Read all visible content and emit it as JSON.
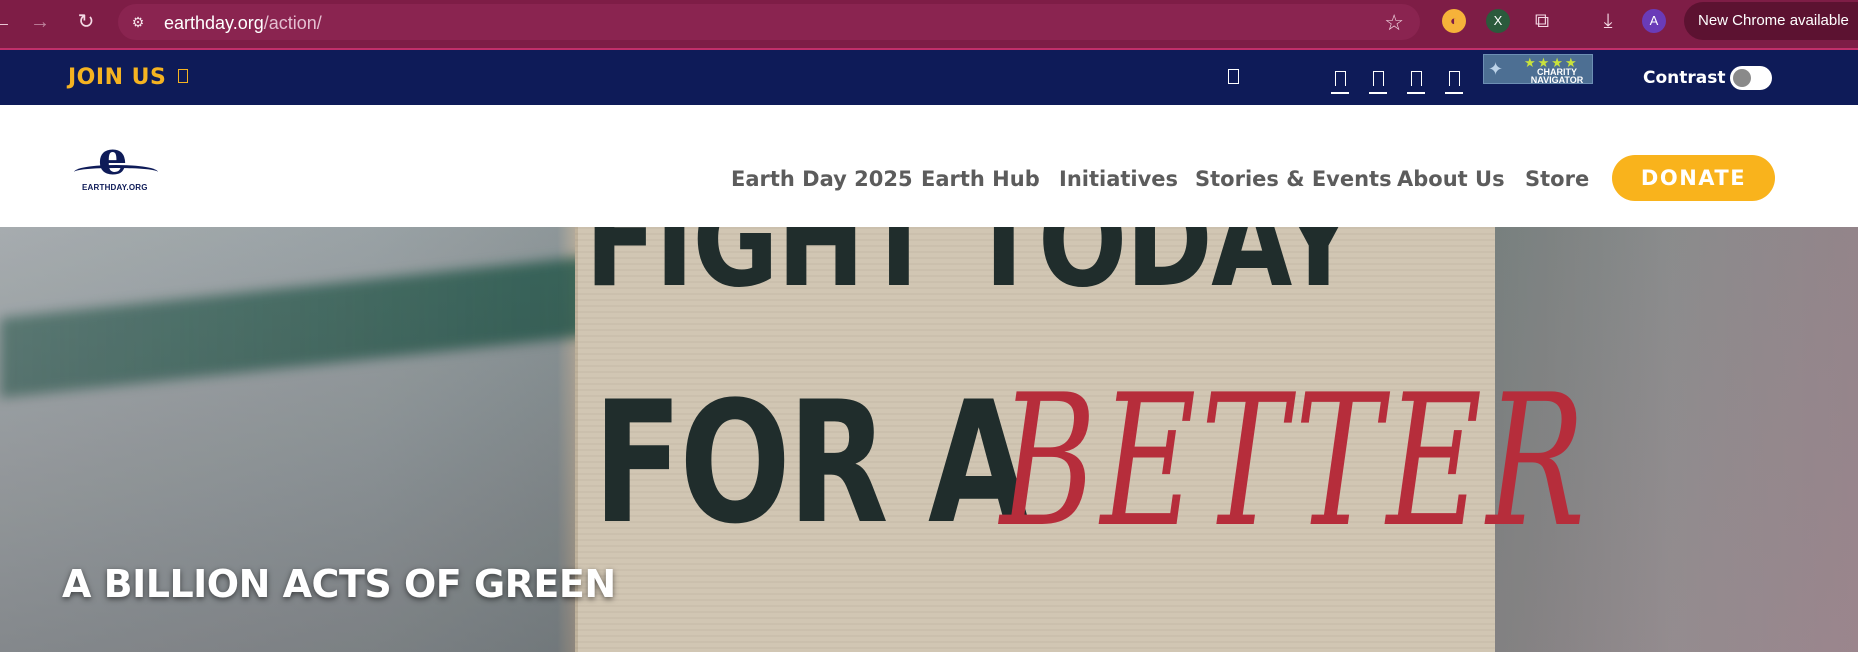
{
  "browser": {
    "url_domain": "earthday.org",
    "url_path": "/action/",
    "new_chrome_label": "New Chrome available",
    "profile_initial": "A",
    "extension_x_label": "X",
    "theme_color": "#7e1d46"
  },
  "topbar": {
    "join_label": "JOIN US",
    "contrast_label": "Contrast",
    "charity_navigator_text": "CHARITY NAVIGATOR",
    "charity_stars": "★★★★",
    "bar_color": "#0e1b58",
    "accent_color": "#f5b321"
  },
  "header": {
    "logo_text": "EARTHDAY.ORG",
    "nav": [
      {
        "label": "Earth Day 2025"
      },
      {
        "label": "Earth Hub"
      },
      {
        "label": "Initiatives"
      },
      {
        "label": "Stories & Events"
      },
      {
        "label": "About Us"
      },
      {
        "label": "Store"
      }
    ],
    "donate_label": "DONATE",
    "donate_color": "#f9b31c"
  },
  "hero": {
    "title": "A BILLION ACTS OF GREEN",
    "sign_line1": "FIGHT TODAY",
    "sign_line2": "FOR A",
    "sign_line3": "BETTER"
  }
}
